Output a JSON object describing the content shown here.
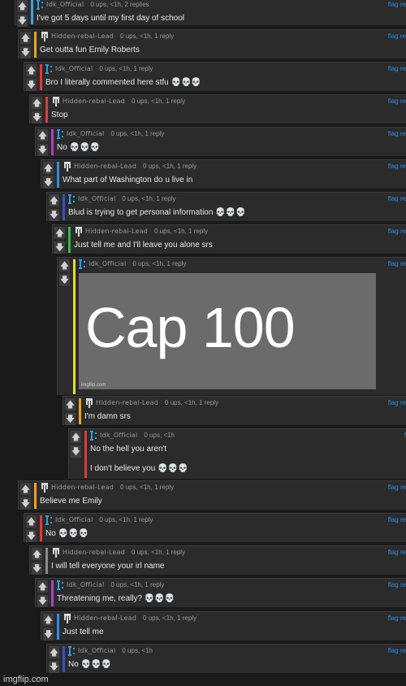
{
  "comments": [
    {
      "user": "Idk_Official",
      "stats": "0 ups, <1h, 2 replies",
      "text": "I've got 5 days until my first day of school",
      "bar": "#3fa1e0",
      "icon": "idk",
      "flag": "flag re"
    },
    {
      "user": "Hidden-rebal-Lead",
      "stats": "0 ups, <1h, 1 reply",
      "text": "Get outta fun Emily Roberts",
      "bar": "#f0a020",
      "icon": "hid",
      "flag": "flag re"
    },
    {
      "user": "Idk_Official",
      "stats": "0 ups, <1h, 1 reply",
      "text": "Bro I literally commented here stfu 💀💀💀",
      "bar": "#e03a3a",
      "icon": "idk",
      "flag": "flag re"
    },
    {
      "user": "Hidden-rebal-Lead",
      "stats": "0 ups, <1h, 1 reply",
      "text": "Stop",
      "bar": "#e03a3a",
      "icon": "hid",
      "flag": "flag re"
    },
    {
      "user": "Idk_Official",
      "stats": "0 ups, <1h, 1 reply",
      "text": "No 💀💀💀",
      "bar": "#b040c0",
      "icon": "idk",
      "flag": "flag re"
    },
    {
      "user": "Hidden-rebal-Lead",
      "stats": "0 ups, <1h, 1 reply",
      "text": "What part of Washington do u live in",
      "bar": "#2f8ee0",
      "icon": "hid",
      "flag": "flag re"
    },
    {
      "user": "Idk_Official",
      "stats": "0 ups, <1h, 1 reply",
      "text": "Blud is trying to get personal information 💀💀💀",
      "bar": "#3a4fd0",
      "icon": "idk",
      "flag": "flag re"
    },
    {
      "user": "Hidden-rebal-Lead",
      "stats": "0 ups, <1h, 1 reply",
      "text": "Just tell me and I'll leave you alone srs",
      "bar": "#30c040",
      "icon": "hid",
      "flag": "flag re"
    },
    {
      "user": "Idk_Official",
      "stats": "0 ups, <1h, 1 reply",
      "text": "",
      "bar": "#e0e020",
      "icon": "idk",
      "flag": "flag re"
    },
    {
      "user": "Hidden-rebal-Lead",
      "stats": "0 ups, <1h, 1 reply",
      "text": "I'm damn srs",
      "bar": "#f0a020",
      "icon": "hid",
      "flag": "flag re"
    },
    {
      "user": "Idk_Official",
      "stats": "0 ups, <1h",
      "text": "No the hell you aren't",
      "text2": "I don't believe you 💀💀💀",
      "bar": "#e03a3a",
      "icon": "idk",
      "flag": "f"
    },
    {
      "user": "Hidden-rebal-Lead",
      "stats": "0 ups, <1h, 1 reply",
      "text": "Believe me Emily",
      "bar": "#f0a020",
      "icon": "hid",
      "flag": "flag re"
    },
    {
      "user": "Idk_Official",
      "stats": "0 ups, <1h, 1 reply",
      "text": "No 💀💀💀",
      "bar": "#e03a3a",
      "icon": "idk",
      "flag": "flag re"
    },
    {
      "user": "Hidden-rebal-Lead",
      "stats": "0 ups, <1h, 1 reply",
      "text": "I will tell everyone your irl name",
      "bar": "#8a8a8a",
      "icon": "hid",
      "flag": "flag re"
    },
    {
      "user": "Idk_Official",
      "stats": "0 ups, <1h, 1 reply",
      "text": "Threatening me, really? 💀💀💀",
      "bar": "#b040c0",
      "icon": "idk",
      "flag": "flag re"
    },
    {
      "user": "Hidden-rebal-Lead",
      "stats": "0 ups, <1h, 1 reply",
      "text": "Just tell me",
      "bar": "#2f8ee0",
      "icon": "hid",
      "flag": "flag re"
    },
    {
      "user": "Idk_Official",
      "stats": "0 ups, <1h",
      "text": "No 💀💀💀",
      "bar": "#3a4fd0",
      "icon": "idk",
      "flag": "flag re"
    }
  ],
  "meme": {
    "text": "Cap 100",
    "mark": "imgflip.com"
  },
  "watermark": "imgflip.com",
  "vote": {
    "up": "🡅",
    "down": "🡇"
  }
}
